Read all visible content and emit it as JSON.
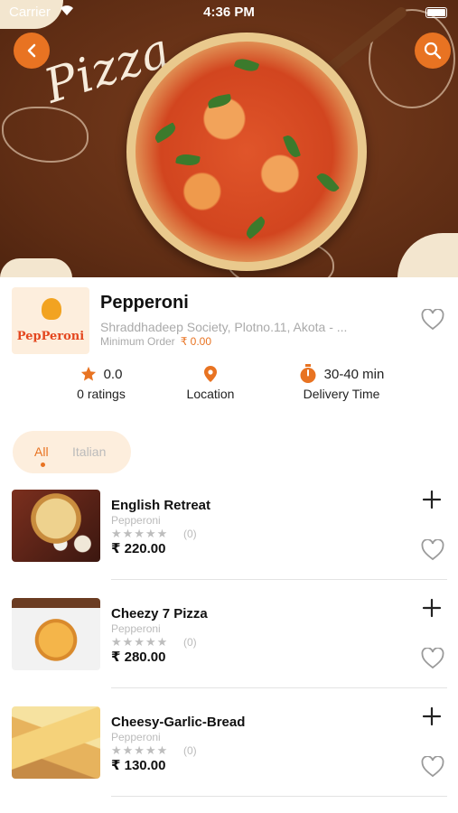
{
  "status_bar": {
    "carrier": "Carrier",
    "time": "4:36 PM"
  },
  "hero": {
    "title_art": "Pizza"
  },
  "restaurant": {
    "name": "Pepperoni",
    "logo_text": "PepPeroni",
    "address": "Shraddhadeep Society, Plotno.11, Akota - ...",
    "min_order_label": "Minimum Order",
    "min_order_value": "₹ 0.00"
  },
  "stats": {
    "rating_value": "0.0",
    "rating_label": "0 ratings",
    "location_label": "Location",
    "delivery_value": "30-40 min",
    "delivery_label": "Delivery Time"
  },
  "categories": [
    {
      "label": "All",
      "selected": true
    },
    {
      "label": "Italian",
      "selected": false
    }
  ],
  "items": [
    {
      "name": "English Retreat",
      "restaurant": "Pepperoni",
      "stars": "★★★★★",
      "rating_count": "(0)",
      "price": "₹ 220.00"
    },
    {
      "name": "Cheezy 7 Pizza",
      "restaurant": "Pepperoni",
      "stars": "★★★★★",
      "rating_count": "(0)",
      "price": "₹ 280.00"
    },
    {
      "name": "Cheesy-Garlic-Bread",
      "restaurant": "Pepperoni",
      "stars": "★★★★★",
      "rating_count": "(0)",
      "price": "₹ 130.00"
    }
  ],
  "icons": {
    "back": "chevron-left-icon",
    "search": "search-icon",
    "favorite": "heart-outline-icon",
    "rating": "star-icon",
    "location": "map-pin-icon",
    "delivery": "stopwatch-icon",
    "add": "plus-icon"
  },
  "colors": {
    "accent": "#e87322",
    "hero_bg": "#6b3418",
    "pill_bg": "#fdeedd"
  }
}
